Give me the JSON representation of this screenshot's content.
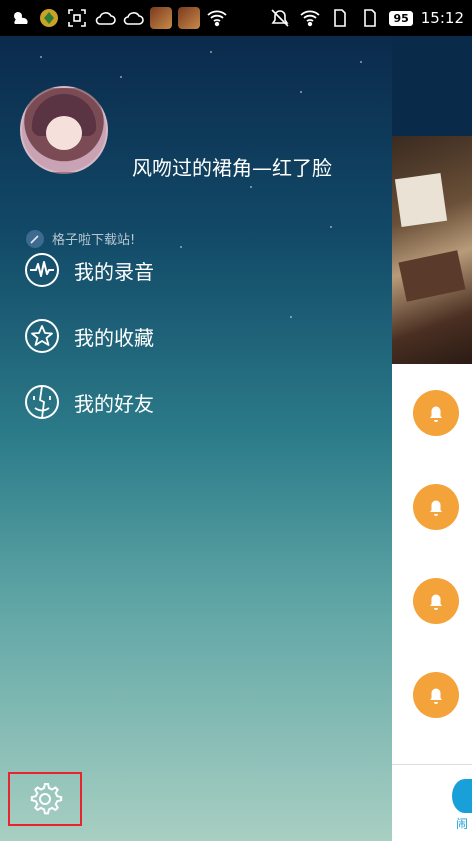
{
  "status_bar": {
    "battery": "95",
    "time": "15:12",
    "icons": [
      "weather-icon",
      "app-icon",
      "screenshot-icon",
      "cloud-icon",
      "cloud-icon",
      "game-icon",
      "game-icon",
      "wifi-icon",
      "mute-icon",
      "wifi-icon",
      "sim-icon",
      "sim-icon"
    ]
  },
  "drawer": {
    "username": "风吻过的裙角—红了脸",
    "signature": "格子啦下载站!",
    "menu": [
      {
        "label": "我的录音",
        "icon": "waveform-icon"
      },
      {
        "label": "我的收藏",
        "icon": "star-icon"
      },
      {
        "label": "我的好友",
        "icon": "friends-icon"
      }
    ],
    "settings_icon": "gear-icon"
  },
  "main_peek": {
    "tab_label": "闹",
    "accent": "#f3a33a",
    "tab_color": "#1aa0d8"
  }
}
